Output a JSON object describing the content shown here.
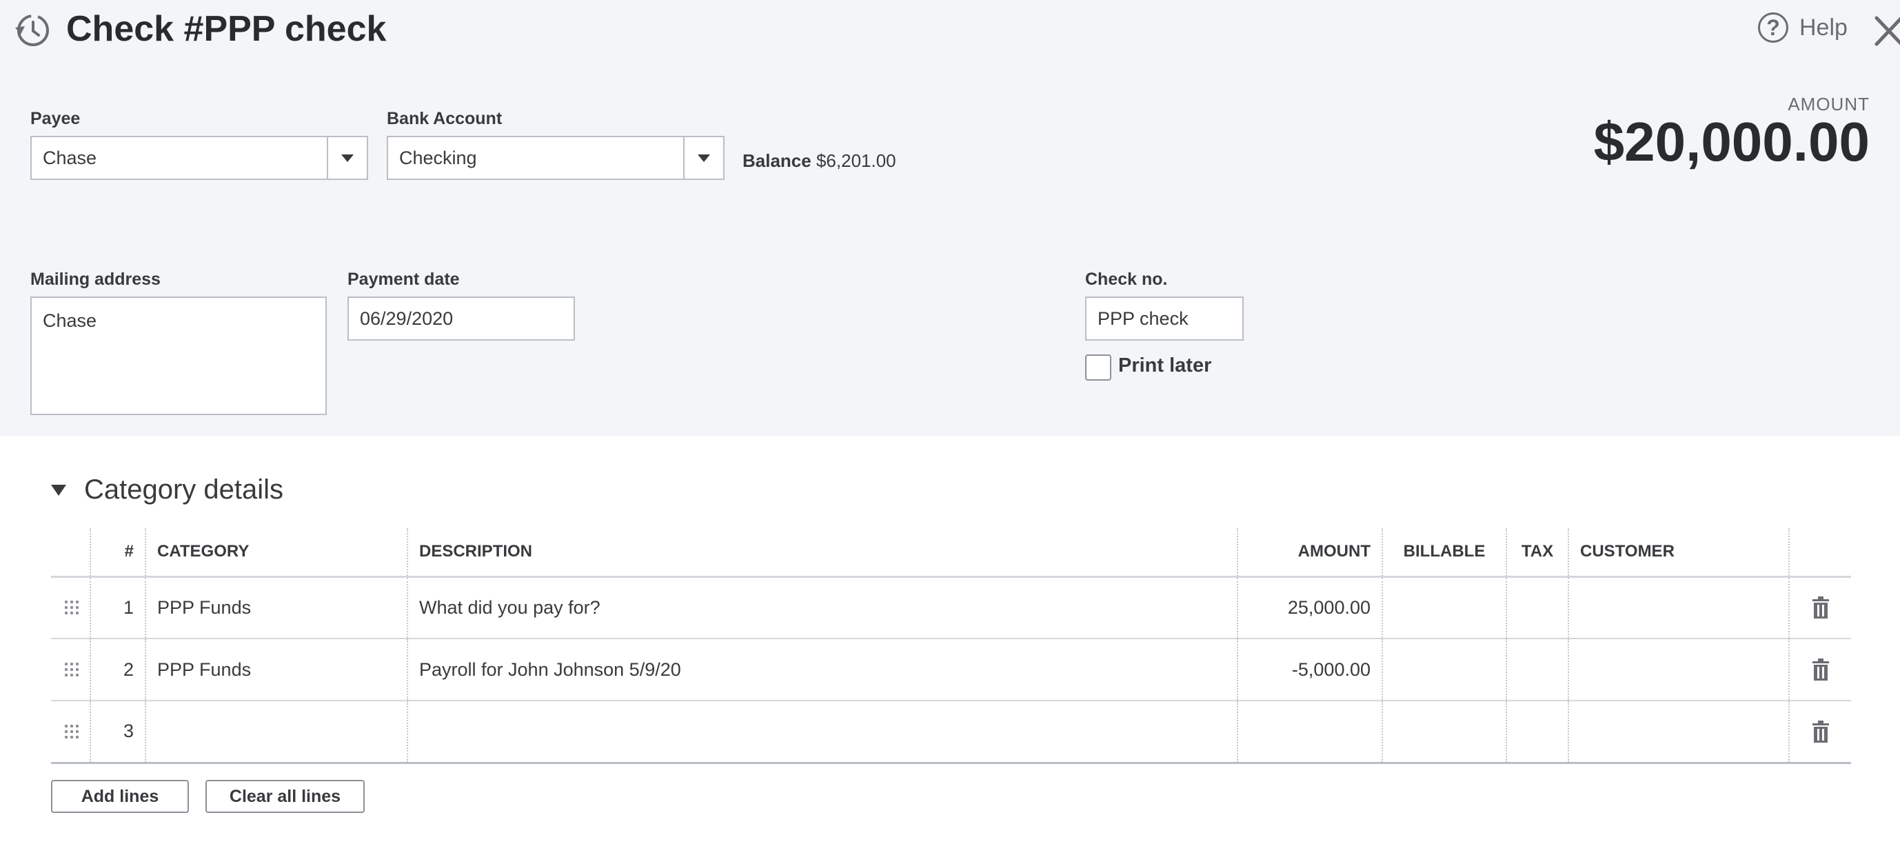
{
  "header": {
    "title": "Check #PPP check",
    "history_icon": "history-clock-icon",
    "help_label": "Help",
    "help_icon": "help-circle-icon",
    "close_icon": "close-icon"
  },
  "form": {
    "payee": {
      "label": "Payee",
      "value": "Chase"
    },
    "bank_account": {
      "label": "Bank Account",
      "value": "Checking"
    },
    "balance": {
      "label": "Balance",
      "value": "$6,201.00"
    },
    "amount": {
      "label": "AMOUNT",
      "value": "$20,000.00"
    },
    "mailing_address": {
      "label": "Mailing address",
      "value": "Chase"
    },
    "payment_date": {
      "label": "Payment date",
      "value": "06/29/2020"
    },
    "check_no": {
      "label": "Check no.",
      "value": "PPP check"
    },
    "print_later": {
      "label": "Print later",
      "checked": false
    }
  },
  "category_details": {
    "title": "Category details",
    "columns": {
      "num": "#",
      "category": "CATEGORY",
      "description": "DESCRIPTION",
      "amount": "AMOUNT",
      "billable": "BILLABLE",
      "tax": "TAX",
      "customer": "CUSTOMER"
    },
    "rows": [
      {
        "num": "1",
        "category": "PPP Funds",
        "description": "",
        "description_placeholder": "What did you pay for?",
        "amount": "25,000.00"
      },
      {
        "num": "2",
        "category": "PPP Funds",
        "description": "Payroll for John Johnson 5/9/20",
        "description_placeholder": "",
        "amount": "-5,000.00"
      },
      {
        "num": "3",
        "category": "",
        "description": "",
        "description_placeholder": "",
        "amount": ""
      }
    ],
    "add_lines_label": "Add lines",
    "clear_lines_label": "Clear all lines"
  }
}
